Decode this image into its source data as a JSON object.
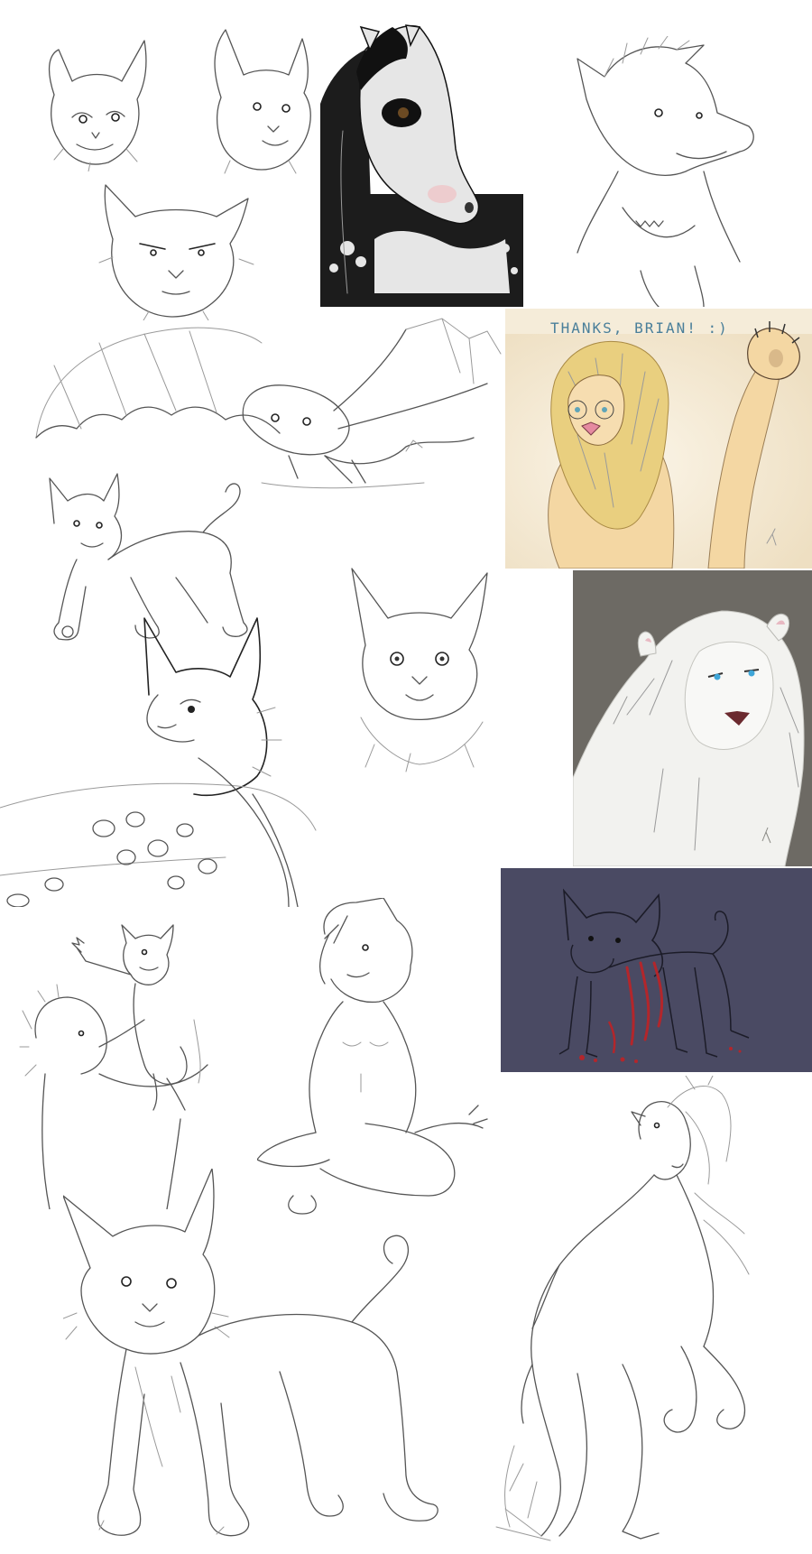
{
  "caption": {
    "text": "THANKS, BRIAN! :)"
  },
  "colors": {
    "background": "#ffffff",
    "sketch_line": "#555555",
    "caption_text": "#4a7f9a",
    "lion_panel_bg": "#f5ecd9",
    "lion_mane": "#e9cf7f",
    "white_lion_bg": "#6d6a64",
    "night_panel_bg": "#4a4a63",
    "blood": "#b3262b",
    "horse_black": "#1c1c1c",
    "horse_white": "#e6e6e6"
  }
}
